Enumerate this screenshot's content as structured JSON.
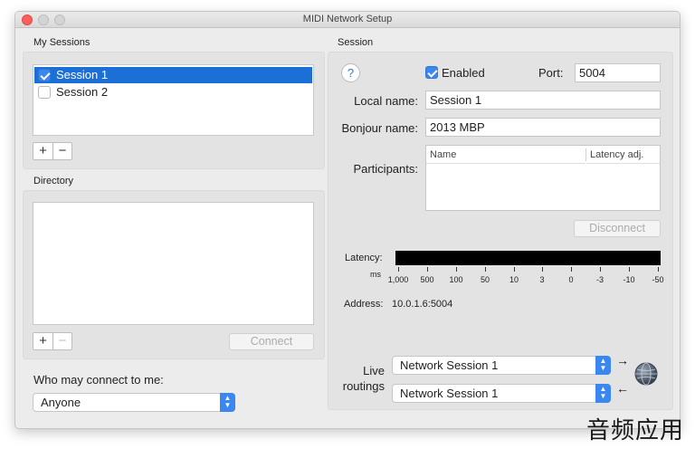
{
  "window": {
    "title": "MIDI Network Setup"
  },
  "my_sessions": {
    "label": "My Sessions",
    "items": [
      {
        "label": "Session 1",
        "checked": true,
        "selected": true
      },
      {
        "label": "Session 2",
        "checked": false,
        "selected": false
      }
    ],
    "add_label": "+",
    "remove_label": "−"
  },
  "directory": {
    "label": "Directory",
    "add_label": "+",
    "remove_label": "−",
    "connect_label": "Connect"
  },
  "who_may_connect": {
    "label": "Who may connect to me:",
    "value": "Anyone"
  },
  "session": {
    "label": "Session",
    "help_label": "?",
    "enabled_label": "Enabled",
    "enabled": true,
    "port_label": "Port:",
    "port_value": "5004",
    "local_name_label": "Local name:",
    "local_name_value": "Session 1",
    "bonjour_name_label": "Bonjour name:",
    "bonjour_name_value": "2013 MBP",
    "participants_label": "Participants:",
    "participants_columns": [
      "Name",
      "Latency adj."
    ],
    "disconnect_label": "Disconnect",
    "latency_label": "Latency:",
    "ms_label": "ms",
    "latency_ticks": [
      "1,000",
      "500",
      "100",
      "50",
      "10",
      "3",
      "0",
      "-3",
      "-10",
      "-50"
    ],
    "address_label": "Address:",
    "address_value": "10.0.1.6:5004",
    "live_routings_label_1": "Live",
    "live_routings_label_2": "routings",
    "routing_out": "Network Session 1",
    "routing_in": "Network Session 1"
  },
  "icons": {
    "arrow_right": "→",
    "arrow_left": "←",
    "globe": "globe-icon"
  },
  "watermark": "音频应用"
}
